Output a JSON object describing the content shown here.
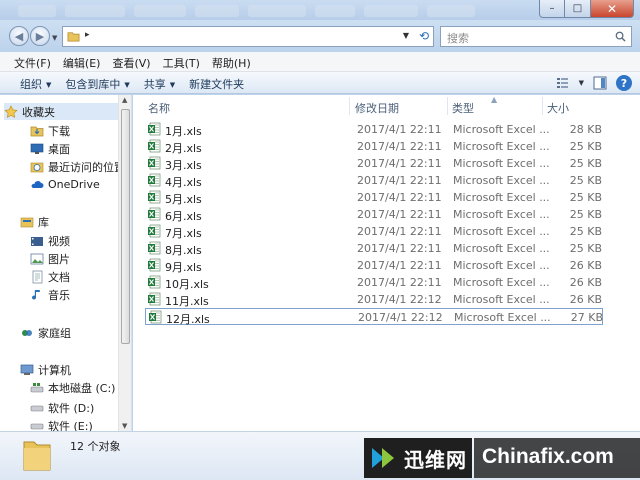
{
  "window": {
    "min_symbol": "–",
    "max_symbol": "□",
    "close_symbol": "✕"
  },
  "address": {
    "arrow": "▸",
    "search_placeholder": "搜索"
  },
  "menu": [
    "文件(F)",
    "编辑(E)",
    "查看(V)",
    "工具(T)",
    "帮助(H)"
  ],
  "commands": {
    "organize": "组织",
    "include_in_library": "包含到库中",
    "share": "共享",
    "new_folder": "新建文件夹"
  },
  "nav_icons": {
    "favorites": "star-icon",
    "downloads": "download-folder-icon",
    "desktop": "desktop-icon",
    "recent": "recent-places-icon",
    "onedrive": "cloud-icon",
    "libraries": "library-icon",
    "videos": "video-icon",
    "pictures": "picture-icon",
    "documents": "document-icon",
    "music": "music-icon",
    "homegroup": "homegroup-icon",
    "computer": "computer-icon",
    "drive": "drive-icon"
  },
  "navigation": {
    "favorites": "收藏夹",
    "downloads": "下载",
    "desktop": "桌面",
    "recent": "最近访问的位置",
    "onedrive": "OneDrive",
    "libraries": "库",
    "videos": "视频",
    "pictures": "图片",
    "documents": "文档",
    "music": "音乐",
    "homegroup": "家庭组",
    "computer": "计算机",
    "drive_c": "本地磁盘 (C:)",
    "drive_d": "软件 (D:)",
    "drive_e": "软件 (E:)"
  },
  "columns": {
    "name": "名称",
    "date": "修改日期",
    "type": "类型",
    "size": "大小"
  },
  "files": [
    {
      "name": "1月.xls",
      "date": "2017/4/1 22:11",
      "type": "Microsoft Excel ...",
      "size": "28 KB"
    },
    {
      "name": "2月.xls",
      "date": "2017/4/1 22:11",
      "type": "Microsoft Excel ...",
      "size": "25 KB"
    },
    {
      "name": "3月.xls",
      "date": "2017/4/1 22:11",
      "type": "Microsoft Excel ...",
      "size": "25 KB"
    },
    {
      "name": "4月.xls",
      "date": "2017/4/1 22:11",
      "type": "Microsoft Excel ...",
      "size": "25 KB"
    },
    {
      "name": "5月.xls",
      "date": "2017/4/1 22:11",
      "type": "Microsoft Excel ...",
      "size": "25 KB"
    },
    {
      "name": "6月.xls",
      "date": "2017/4/1 22:11",
      "type": "Microsoft Excel ...",
      "size": "25 KB"
    },
    {
      "name": "7月.xls",
      "date": "2017/4/1 22:11",
      "type": "Microsoft Excel ...",
      "size": "25 KB"
    },
    {
      "name": "8月.xls",
      "date": "2017/4/1 22:11",
      "type": "Microsoft Excel ...",
      "size": "25 KB"
    },
    {
      "name": "9月.xls",
      "date": "2017/4/1 22:11",
      "type": "Microsoft Excel ...",
      "size": "26 KB"
    },
    {
      "name": "10月.xls",
      "date": "2017/4/1 22:11",
      "type": "Microsoft Excel ...",
      "size": "26 KB"
    },
    {
      "name": "11月.xls",
      "date": "2017/4/1 22:12",
      "type": "Microsoft Excel ...",
      "size": "26 KB"
    },
    {
      "name": "12月.xls",
      "date": "2017/4/1 22:12",
      "type": "Microsoft Excel ...",
      "size": "27 KB"
    }
  ],
  "selected_file_index": 11,
  "status": {
    "item_count": "12 个对象"
  },
  "watermark": {
    "cn": "迅维网",
    "en": "Chinafix.com"
  },
  "colors": {
    "chrome": "#bcd3ec",
    "command_text": "#1e395b",
    "selection_border": "#7da2ce",
    "excel_green": "#1f7a3c"
  }
}
